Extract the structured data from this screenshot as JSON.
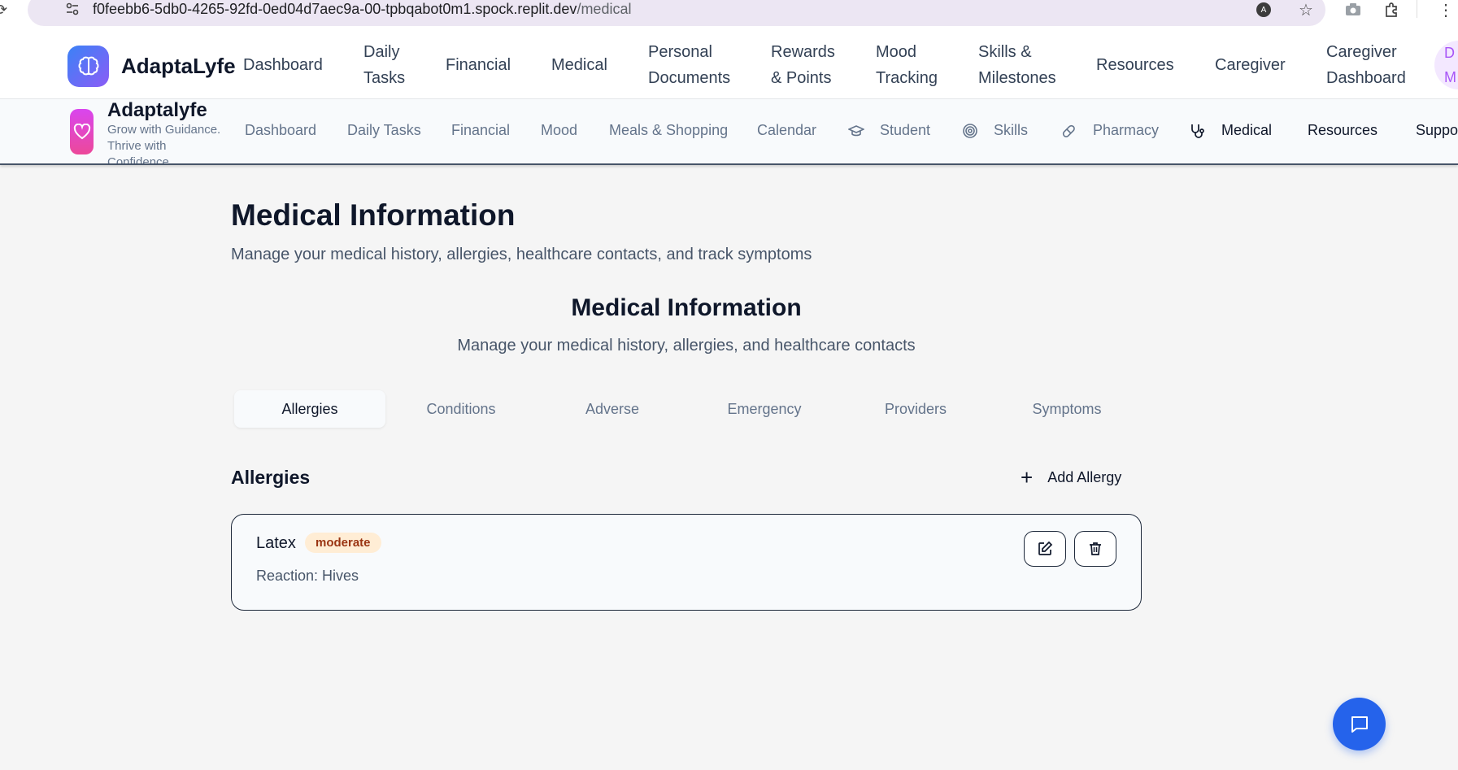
{
  "browser": {
    "url_host": "f0feebb6-5db0-4265-92fd-0ed04d7aec9a-00-tpbqabot0m1.spock.replit.dev",
    "url_path": "/medical",
    "profile_initial": "A"
  },
  "top_nav": {
    "brand": "AdaptaLyfe",
    "links": [
      {
        "l1": "Dashboard",
        "l2": ""
      },
      {
        "l1": "Daily",
        "l2": "Tasks"
      },
      {
        "l1": "Financial",
        "l2": ""
      },
      {
        "l1": "Medical",
        "l2": ""
      },
      {
        "l1": "Personal",
        "l2": "Documents"
      },
      {
        "l1": "Rewards",
        "l2": "& Points"
      },
      {
        "l1": "Mood",
        "l2": "Tracking"
      },
      {
        "l1": "Skills &",
        "l2": "Milestones"
      },
      {
        "l1": "Resources",
        "l2": ""
      },
      {
        "l1": "Caregiver",
        "l2": ""
      },
      {
        "l1": "Caregiver",
        "l2": "Dashboard"
      }
    ],
    "avatar_text_1": "D",
    "avatar_text_2": "M"
  },
  "sub_nav": {
    "brand": "Adaptalyfe",
    "tagline": "Grow with Guidance. Thrive with Confidence.",
    "links": [
      "Dashboard",
      "Daily Tasks",
      "Financial",
      "Mood",
      "Meals & Shopping",
      "Calendar",
      "Student",
      "Skills",
      "Pharmacy",
      "Medical",
      "Resources",
      "Suppo"
    ]
  },
  "page": {
    "title": "Medical Information",
    "subtitle": "Manage your medical history, allergies, healthcare contacts, and track symptoms",
    "section_title": "Medical Information",
    "section_subtitle": "Manage your medical history, allergies, and healthcare contacts"
  },
  "tabs": [
    "Allergies",
    "Conditions",
    "Adverse",
    "Emergency",
    "Providers",
    "Symptoms"
  ],
  "allergies": {
    "title": "Allergies",
    "add_label": "Add Allergy",
    "items": [
      {
        "name": "Latex",
        "severity": "moderate",
        "reaction": "Reaction: Hives"
      }
    ]
  },
  "colors": {
    "accent": "#2563eb",
    "severity_bg": "#ffedd5",
    "severity_text": "#9a3412"
  }
}
